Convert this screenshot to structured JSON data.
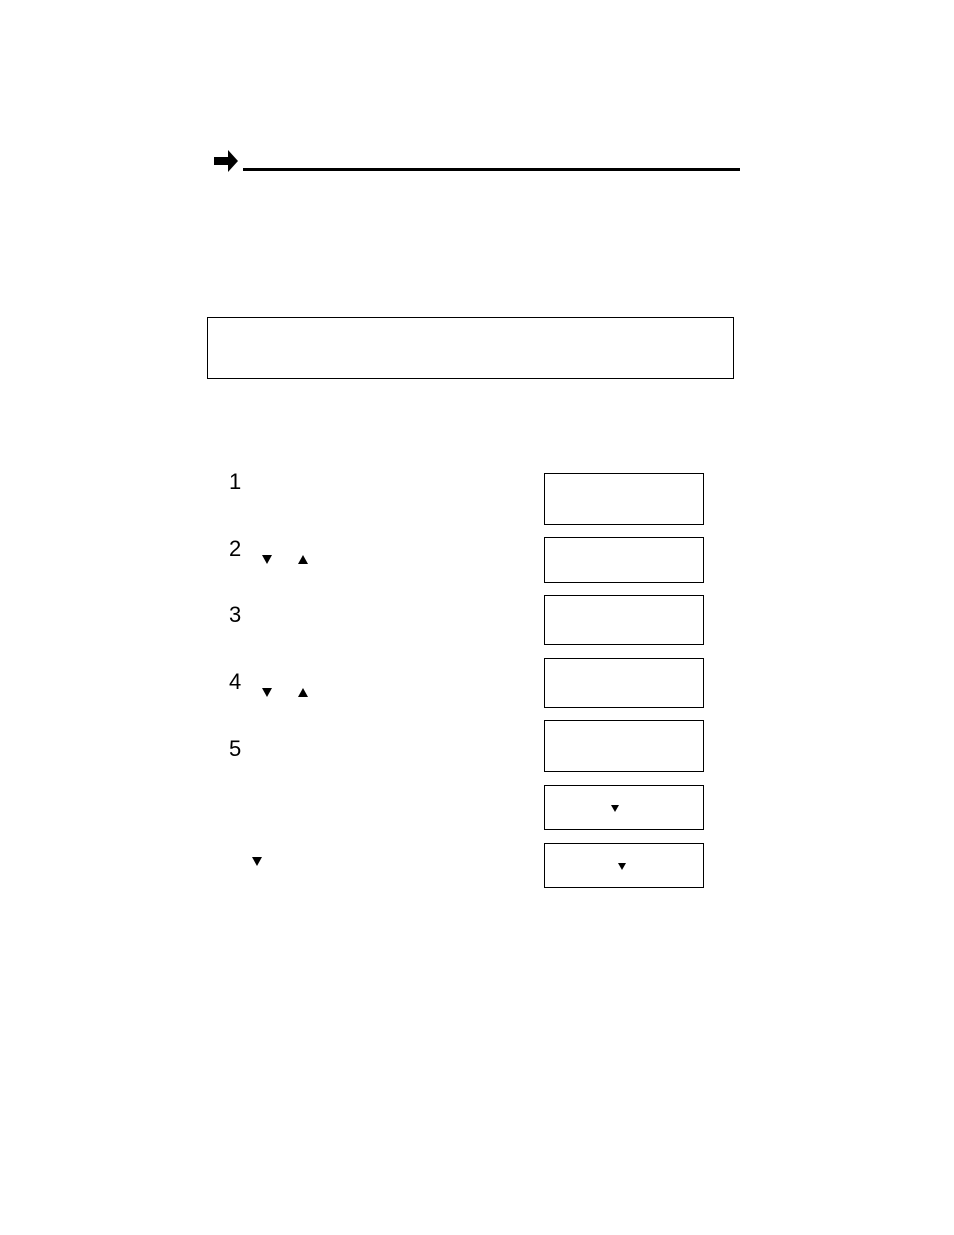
{
  "list": {
    "n1": "1",
    "n2": "2",
    "n3": "3",
    "n4": "4",
    "n5": "5"
  },
  "icons": {
    "arrow": "right-arrow",
    "down": "triangle-down",
    "up": "triangle-up"
  }
}
